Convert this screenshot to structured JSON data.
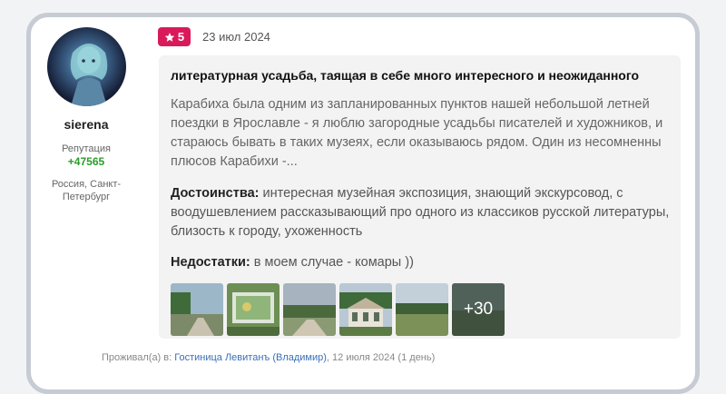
{
  "user": {
    "name": "sierena",
    "reputation_label": "Репутация",
    "reputation_value": "+47565",
    "location": "Россия, Санкт-Петербург"
  },
  "review": {
    "rating": "5",
    "date": "23 июл 2024",
    "title": "литературная усадьба, таящая в себе много интересного и неожиданного",
    "text": "Карабиха была одним из запланированных пунктов нашей небольшой летней поездки в Ярославле - я люблю загородные усадьбы писателей и художников, и стараюсь бывать в таких музеях, если оказываюсь рядом. Один из несомненны плюсов Карабихи -...",
    "pros_label": "Достоинства:",
    "pros": "интересная музейная экспозиция, знающий экскурсовод, с воодушевлением рассказывающий про одного из классиков русской литературы, близость к городу, ухоженность",
    "cons_label": "Недостатки:",
    "cons": "в моем случае - комары ))",
    "more_photos": "+30"
  },
  "stay": {
    "prefix": "Проживал(а) в:",
    "hotel": "Гостиница Левитанъ (Владимир)",
    "suffix": ", 12 июля 2024 (1 день)"
  },
  "colors": {
    "badge": "#d91a5a",
    "reputation": "#2a9d2a",
    "link": "#3b6fb8"
  }
}
